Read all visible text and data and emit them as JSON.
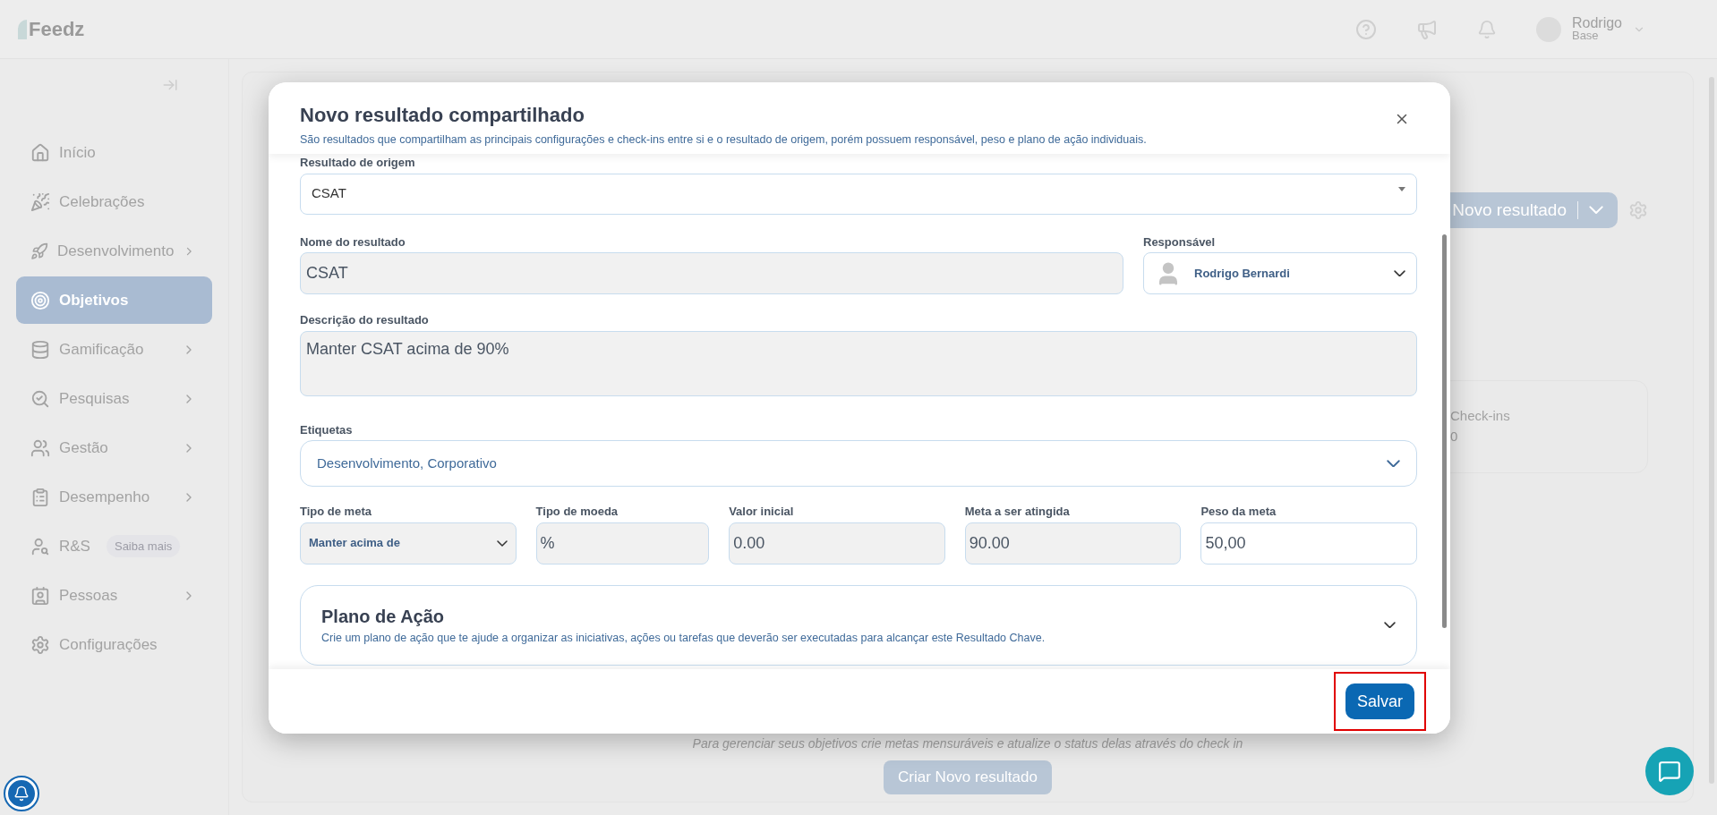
{
  "app": {
    "logo": "Feedz"
  },
  "header": {
    "user_name": "Rodrigo",
    "user_company": "Base"
  },
  "sidebar": {
    "items": [
      {
        "label": "Início",
        "selected": false,
        "expandable": false
      },
      {
        "label": "Celebrações",
        "selected": false,
        "expandable": false
      },
      {
        "label": "Desenvolvimento",
        "selected": false,
        "expandable": true
      },
      {
        "label": "Objetivos",
        "selected": true,
        "expandable": false
      },
      {
        "label": "Gamificação",
        "selected": false,
        "expandable": true
      },
      {
        "label": "Pesquisas",
        "selected": false,
        "expandable": true
      },
      {
        "label": "Gestão",
        "selected": false,
        "expandable": true
      },
      {
        "label": "Desempenho",
        "selected": false,
        "expandable": true
      },
      {
        "label": "R&S",
        "selected": false,
        "expandable": false,
        "badge": "Saiba mais"
      },
      {
        "label": "Pessoas",
        "selected": false,
        "expandable": true
      },
      {
        "label": "Configurações",
        "selected": false,
        "expandable": false
      }
    ]
  },
  "background": {
    "new_result_button": "Novo resultado",
    "checkins": {
      "label": "Check-ins",
      "value": "0"
    },
    "empty_hint": "Para gerenciar seus objetivos crie metas mensuráveis e atualize o status delas através do check in",
    "create_button": "Criar Novo resultado"
  },
  "modal": {
    "title": "Novo resultado compartilhado",
    "subtitle": "São resultados que compartilham as principais configurações e check-ins entre si e o resultado de origem, porém possuem responsável, peso e plano de ação individuais.",
    "origin": {
      "label": "Resultado de origem",
      "value": "CSAT"
    },
    "name": {
      "label": "Nome do resultado",
      "value": "CSAT",
      "disabled": true
    },
    "owner": {
      "label": "Responsável",
      "value": "Rodrigo Bernardi"
    },
    "description": {
      "label": "Descrição do resultado",
      "value": "Manter CSAT acima de 90%",
      "disabled": true
    },
    "tags": {
      "label": "Etiquetas",
      "value": "Desenvolvimento, Corporativo"
    },
    "goal_fields": [
      {
        "label": "Tipo de meta",
        "value": "Manter acima de",
        "kind": "select",
        "disabled": true
      },
      {
        "label": "Tipo de moeda",
        "value": "%",
        "kind": "text",
        "disabled": true
      },
      {
        "label": "Valor inicial",
        "value": "0.00",
        "kind": "text",
        "disabled": true
      },
      {
        "label": "Meta a ser atingida",
        "value": "90.00",
        "kind": "text",
        "disabled": true
      },
      {
        "label": "Peso da meta",
        "value": "50,00",
        "kind": "text",
        "disabled": false
      }
    ],
    "action_plan": {
      "title": "Plano de Ação",
      "description": "Crie um plano de ação que te ajude a organizar as iniciativas, ações ou tarefas que deverão ser executadas para alcançar este Resultado Chave.",
      "expanded": false
    },
    "save_button": {
      "label": "Salvar",
      "highlighted": true
    }
  }
}
